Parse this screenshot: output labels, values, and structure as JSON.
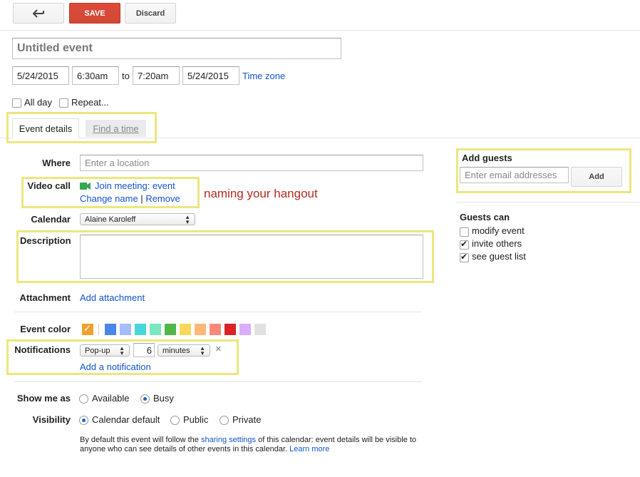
{
  "toolbar": {
    "save_label": "SAVE",
    "discard_label": "Discard",
    "back_icon": "back-arrow-icon"
  },
  "event": {
    "title_placeholder": "Untitled event",
    "start_date": "5/24/2015",
    "start_time": "6:30am",
    "to_label": "to",
    "end_time": "7:20am",
    "end_date": "5/24/2015",
    "time_zone_label": "Time zone",
    "all_day_label": "All day",
    "repeat_label": "Repeat..."
  },
  "tabs": [
    {
      "label": "Event details"
    },
    {
      "label": "Find a time"
    }
  ],
  "details": {
    "where_label": "Where",
    "where_placeholder": "Enter a location",
    "video_call_label": "Video call",
    "join_meeting_label": "Join meeting: event",
    "change_name_label": "Change name",
    "separator": "|",
    "remove_label": "Remove",
    "annotation": "naming your hangout",
    "calendar_label": "Calendar",
    "calendar_value": "Alaine Karoleff",
    "description_label": "Description",
    "attachment_label": "Attachment",
    "add_attachment_label": "Add attachment",
    "event_color_label": "Event color",
    "colors": [
      "#f0a030",
      "#4986e7",
      "#a4bdfc",
      "#46d6db",
      "#7ae7bf",
      "#51b749",
      "#fbd75b",
      "#ffb878",
      "#ff887c",
      "#dc2127",
      "#dbadff",
      "#e1e1e1"
    ],
    "notifications_label": "Notifications",
    "notification_method": "Pop-up",
    "notification_value": "6",
    "notification_unit": "minutes",
    "remove_notification_glyph": "×",
    "add_notification_label": "Add a notification",
    "show_me_as_label": "Show me as",
    "available_label": "Available",
    "busy_label": "Busy",
    "visibility_label": "Visibility",
    "calendar_default_label": "Calendar default",
    "public_label": "Public",
    "private_label": "Private",
    "footnote_part1": "By default this event will follow the ",
    "footnote_link": "sharing settings",
    "footnote_part2": " of this calendar: event details will be visible to",
    "footnote_line2": "anyone who can see details of other events in this calendar.",
    "learn_more_label": "Learn more"
  },
  "guests": {
    "add_guests_label": "Add guests",
    "email_placeholder": "Enter email addresses",
    "add_button_label": "Add",
    "guests_can_label": "Guests can",
    "options": [
      {
        "label": "modify event",
        "checked": false
      },
      {
        "label": "invite others",
        "checked": true
      },
      {
        "label": "see guest list",
        "checked": true
      }
    ]
  }
}
